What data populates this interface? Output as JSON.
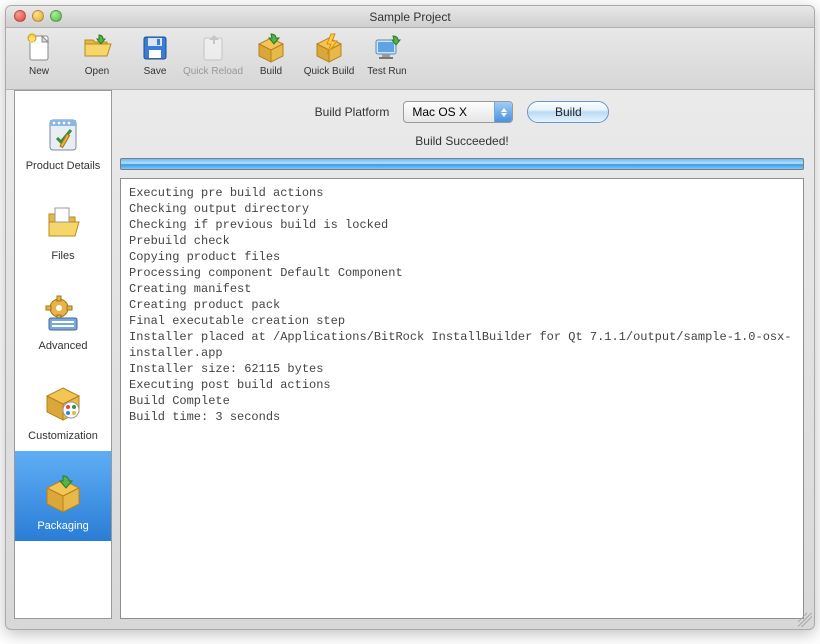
{
  "window": {
    "title": "Sample Project"
  },
  "toolbar": {
    "new": "New",
    "open": "Open",
    "save": "Save",
    "quick_reload": "Quick Reload",
    "build": "Build",
    "quick_build": "Quick Build",
    "test_run": "Test Run"
  },
  "sidebar": {
    "items": [
      {
        "label": "Product Details"
      },
      {
        "label": "Files"
      },
      {
        "label": "Advanced"
      },
      {
        "label": "Customization"
      },
      {
        "label": "Packaging"
      }
    ],
    "selected_index": 4
  },
  "build": {
    "platform_label": "Build Platform",
    "platform_selected": "Mac OS X",
    "button_label": "Build",
    "status": "Build Succeeded!"
  },
  "log": "Executing pre build actions\nChecking output directory\nChecking if previous build is locked\nPrebuild check\nCopying product files\nProcessing component Default Component\nCreating manifest\nCreating product pack\nFinal executable creation step\nInstaller placed at /Applications/BitRock InstallBuilder for Qt 7.1.1/output/sample-1.0-osx-installer.app\nInstaller size: 62115 bytes\nExecuting post build actions\nBuild Complete\nBuild time: 3 seconds"
}
